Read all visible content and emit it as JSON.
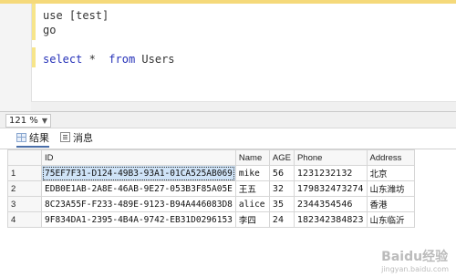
{
  "editor": {
    "lines": [
      {
        "text": "use [test]"
      },
      {
        "text": "go"
      },
      {
        "text": ""
      },
      {
        "kw": "select",
        "rest": " *  ",
        "kw2": "from",
        "rest2": " Users"
      }
    ]
  },
  "zoom": {
    "value": "121 %"
  },
  "results_tabs": [
    {
      "label": "结果",
      "icon": "grid-icon",
      "active": true
    },
    {
      "label": "消息",
      "icon": "message-icon",
      "active": false
    }
  ],
  "grid": {
    "columns": [
      "ID",
      "Name",
      "AGE",
      "Phone",
      "Address"
    ],
    "rows": [
      {
        "rownum": "1",
        "cells": [
          "75EF7F31-D124-49B3-93A1-01CA525AB069",
          "mike",
          "56",
          "1231232132",
          "北京"
        ]
      },
      {
        "rownum": "2",
        "cells": [
          "EDB0E1AB-2A8E-46AB-9E27-053B3F85A05E",
          "王五",
          "32",
          "179832473274",
          "山东潍坊"
        ]
      },
      {
        "rownum": "3",
        "cells": [
          "8C23A55F-F233-489E-9123-B94A446083D8",
          "alice",
          "35",
          "2344354546",
          "香港"
        ]
      },
      {
        "rownum": "4",
        "cells": [
          "9F834DA1-2395-4B4A-9742-EB31D0296153",
          "李四",
          "24",
          "182342384823",
          "山东临沂"
        ]
      }
    ]
  },
  "watermark": {
    "text": "Baidu经验",
    "sub": "jingyan.baidu.com"
  }
}
